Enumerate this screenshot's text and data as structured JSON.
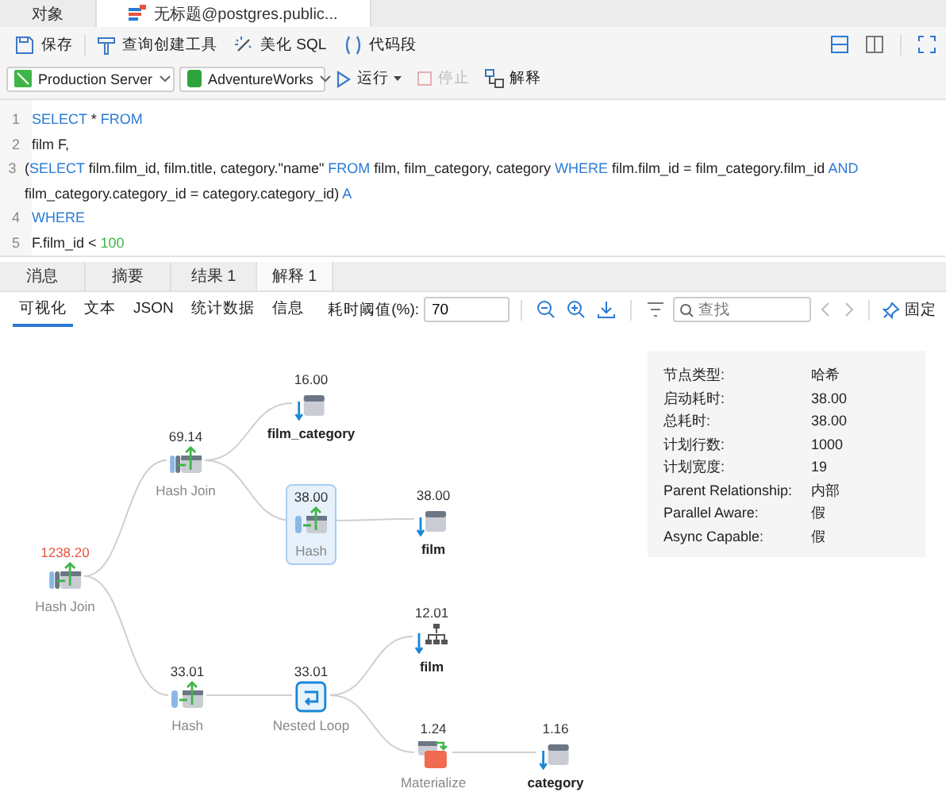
{
  "tabs": [
    {
      "label": "对象",
      "selected": false,
      "kind": "plain"
    },
    {
      "label": "无标题@postgres.public...",
      "selected": true,
      "kind": "query"
    }
  ],
  "toolbar": [
    {
      "label": "保存",
      "kind": "save"
    },
    {
      "label": "查询创建工具",
      "kind": "builder"
    },
    {
      "label": "美化 SQL",
      "kind": "wand"
    },
    {
      "label": "代码段",
      "kind": "snippet"
    }
  ],
  "connection": {
    "server": "Production Server",
    "database": "AdventureWorks"
  },
  "actions": [
    {
      "label": "运行",
      "kind": "run",
      "disabled": false,
      "menu": true
    },
    {
      "label": "停止",
      "kind": "stop",
      "disabled": true,
      "menu": false
    },
    {
      "label": "解释",
      "kind": "explain",
      "disabled": false,
      "menu": false
    }
  ],
  "editor": {
    "lines": [
      {
        "number": "1",
        "tokens": [
          {
            "text": "SELECT",
            "kind": "keyword"
          },
          {
            "text": " * ",
            "kind": "plain"
          },
          {
            "text": "FROM",
            "kind": "keyword"
          }
        ]
      },
      {
        "number": "2",
        "tokens": [
          {
            "text": "film F,",
            "kind": "plain"
          }
        ]
      },
      {
        "number": "3",
        "tokens": [
          {
            "text": "(",
            "kind": "plain"
          },
          {
            "text": "SELECT",
            "kind": "keyword"
          },
          {
            "text": " film.film_id, film.title, category.\"name\" ",
            "kind": "plain"
          },
          {
            "text": "FROM",
            "kind": "keyword"
          },
          {
            "text": " film, film_category, category ",
            "kind": "plain"
          },
          {
            "text": "WHERE",
            "kind": "keyword"
          },
          {
            "text": " film.film_id = film_category.film_id ",
            "kind": "plain"
          },
          {
            "text": "AND",
            "kind": "keyword"
          },
          {
            "text": " film_category.category_id = category.category_id) ",
            "kind": "plain"
          },
          {
            "text": "A",
            "kind": "keyword"
          }
        ]
      },
      {
        "number": "4",
        "tokens": [
          {
            "text": "WHERE",
            "kind": "keyword"
          }
        ]
      },
      {
        "number": "5",
        "tokens": [
          {
            "text": "F.film_id < ",
            "kind": "plain"
          },
          {
            "text": "100",
            "kind": "number"
          }
        ]
      }
    ]
  },
  "result_tabs": [
    {
      "label": "消息",
      "selected": false
    },
    {
      "label": "摘要",
      "selected": false
    },
    {
      "label": "结果 1",
      "selected": false
    },
    {
      "label": "解释 1",
      "selected": true
    }
  ],
  "view_tabs": [
    {
      "label": "可视化",
      "selected": true
    },
    {
      "label": "文本",
      "selected": false
    },
    {
      "label": "JSON",
      "selected": false
    },
    {
      "label": "统计数据",
      "selected": false
    },
    {
      "label": "信息",
      "selected": false
    }
  ],
  "threshold": {
    "label": "耗时阈值(%):",
    "value": "70"
  },
  "search": {
    "placeholder": "查找"
  },
  "pin": {
    "label": "固定"
  },
  "plan": {
    "cost": "1238.20",
    "label": "Hash Join",
    "kind": "hash-join",
    "over_threshold": true,
    "selected": false,
    "children": [
      {
        "cost": "69.14",
        "label": "Hash Join",
        "kind": "hash-join",
        "over_threshold": false,
        "selected": false,
        "children": [
          {
            "cost": "16.00",
            "label": "film_category",
            "kind": "seq-scan",
            "over_threshold": false,
            "selected": false
          },
          {
            "cost": "38.00",
            "label": "Hash",
            "kind": "hash",
            "over_threshold": false,
            "selected": true,
            "children": [
              {
                "cost": "38.00",
                "label": "film",
                "kind": "seq-scan",
                "over_threshold": false,
                "selected": false
              }
            ]
          }
        ]
      },
      {
        "cost": "33.01",
        "label": "Hash",
        "kind": "hash",
        "over_threshold": false,
        "selected": false,
        "children": [
          {
            "cost": "33.01",
            "label": "Nested Loop",
            "kind": "nested-loop",
            "over_threshold": false,
            "selected": false,
            "children": [
              {
                "cost": "12.01",
                "label": "film",
                "kind": "index-scan",
                "over_threshold": false,
                "selected": false
              },
              {
                "cost": "1.24",
                "label": "Materialize",
                "kind": "materialize",
                "over_threshold": false,
                "selected": false,
                "children": [
                  {
                    "cost": "1.16",
                    "label": "category",
                    "kind": "seq-scan",
                    "over_threshold": false,
                    "selected": false
                  }
                ]
              }
            ]
          }
        ]
      }
    ]
  },
  "details": [
    {
      "label": "节点类型:",
      "value": "哈希"
    },
    {
      "label": "启动耗时:",
      "value": "38.00"
    },
    {
      "label": "总耗时:",
      "value": "38.00"
    },
    {
      "label": "计划行数:",
      "value": "1000"
    },
    {
      "label": "计划宽度:",
      "value": "19"
    },
    {
      "label": "Parent Relationship:",
      "value": "内部"
    },
    {
      "label": "Parallel Aware:",
      "value": "假"
    },
    {
      "label": "Async Capable:",
      "value": "假"
    }
  ]
}
